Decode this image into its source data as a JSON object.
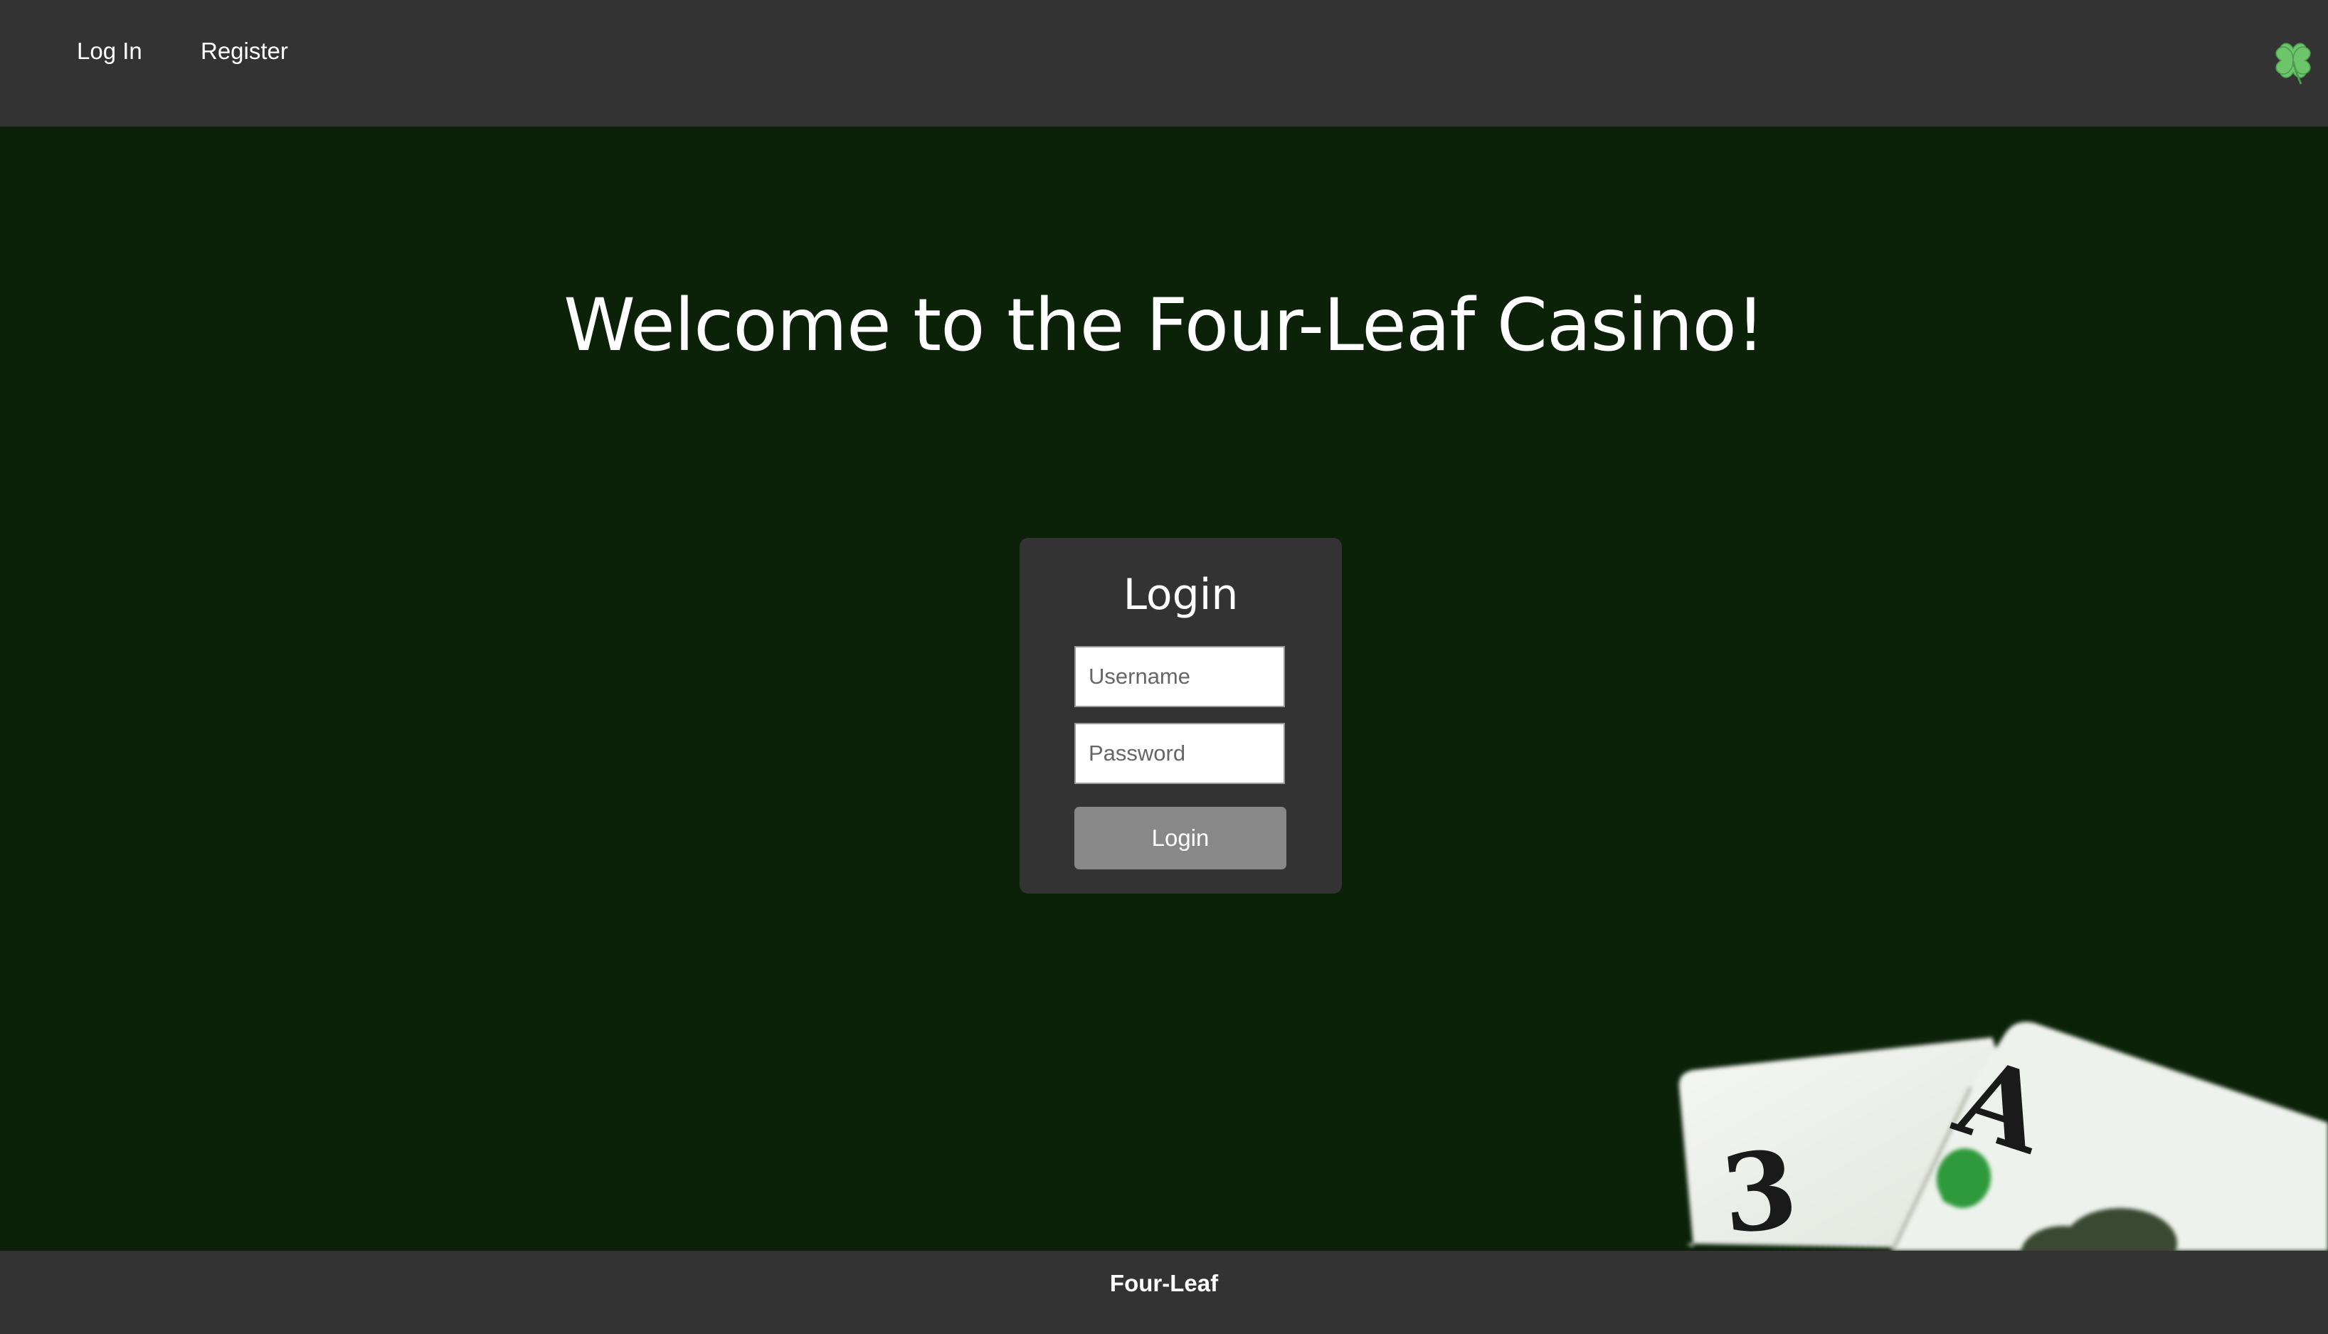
{
  "nav": {
    "login_label": "Log In",
    "register_label": "Register",
    "logo_icon": "four-leaf-clover-icon",
    "logo_color": "#6cc56a"
  },
  "main": {
    "headline": "Welcome to the Four-Leaf Casino!",
    "background_color": "#0b2209",
    "cards_icon": "playing-cards-illustration"
  },
  "login_form": {
    "title": "Login",
    "username_placeholder": "Username",
    "username_value": "",
    "password_placeholder": "Password",
    "password_value": "",
    "submit_label": "Login"
  },
  "footer": {
    "text": "Four-Leaf"
  }
}
